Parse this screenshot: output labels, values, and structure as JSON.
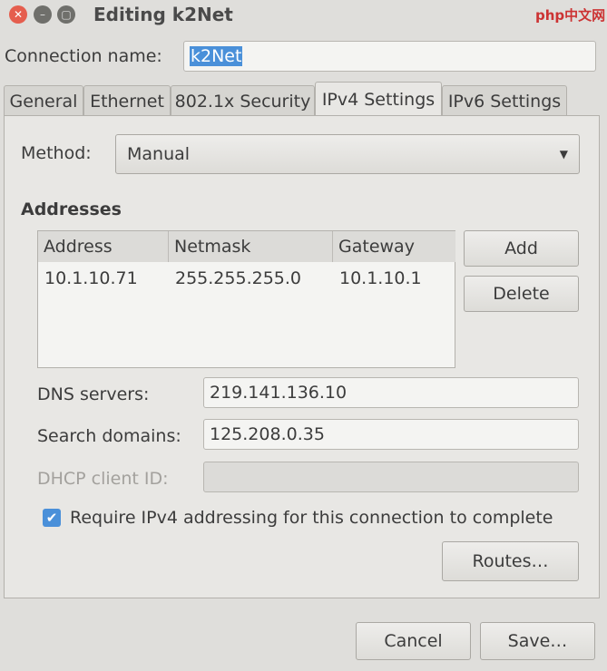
{
  "window": {
    "title": "Editing k2Net"
  },
  "connection_name": {
    "label": "Connection name:",
    "value": "k2Net"
  },
  "tabs": [
    "General",
    "Ethernet",
    "802.1x Security",
    "IPv4 Settings",
    "IPv6 Settings"
  ],
  "method": {
    "label": "Method:",
    "value": "Manual"
  },
  "addresses": {
    "heading": "Addresses",
    "columns": [
      "Address",
      "Netmask",
      "Gateway"
    ],
    "rows": [
      [
        "10.1.10.71",
        "255.255.255.0",
        "10.1.10.1"
      ]
    ],
    "add": "Add",
    "delete": "Delete"
  },
  "dns": {
    "label": "DNS servers:",
    "value": "219.141.136.10"
  },
  "search": {
    "label": "Search domains:",
    "value": "125.208.0.35"
  },
  "dhcp": {
    "label": "DHCP client ID:",
    "value": ""
  },
  "require": {
    "label": "Require IPv4 addressing for this connection to complete",
    "checked": true
  },
  "routes": "Routes…",
  "cancel": "Cancel",
  "save": "Save…",
  "watermark": "php中文网"
}
